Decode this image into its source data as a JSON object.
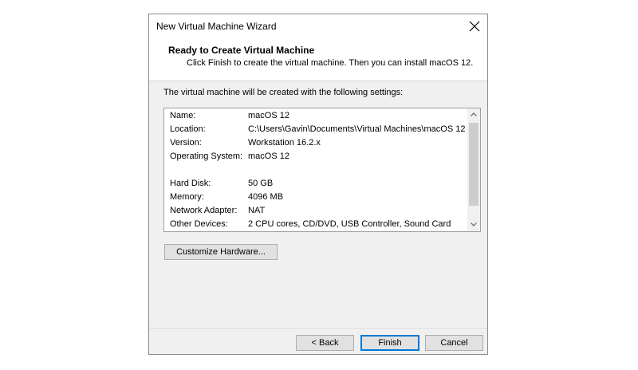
{
  "window": {
    "title": "New Virtual Machine Wizard"
  },
  "header": {
    "title": "Ready to Create Virtual Machine",
    "subtitle": "Click Finish to create the virtual machine. Then you can install macOS 12."
  },
  "intro": "The virtual machine will be created with the following settings:",
  "settings": [
    {
      "label": "Name:",
      "value": "macOS 12"
    },
    {
      "label": "Location:",
      "value": "C:\\Users\\Gavin\\Documents\\Virtual Machines\\macOS 12"
    },
    {
      "label": "Version:",
      "value": "Workstation 16.2.x"
    },
    {
      "label": "Operating System:",
      "value": "macOS 12"
    },
    {
      "label": "",
      "value": ""
    },
    {
      "label": "Hard Disk:",
      "value": "50 GB"
    },
    {
      "label": "Memory:",
      "value": "4096 MB"
    },
    {
      "label": "Network Adapter:",
      "value": "NAT"
    },
    {
      "label": "Other Devices:",
      "value": "2 CPU cores, CD/DVD, USB Controller, Sound Card"
    }
  ],
  "buttons": {
    "customize": "Customize Hardware...",
    "back": "< Back",
    "finish": "Finish",
    "cancel": "Cancel"
  },
  "icons": {
    "close": "close-icon",
    "scroll_up": "chevron-up-icon",
    "scroll_down": "chevron-down-icon"
  },
  "colors": {
    "default_button_border": "#0078d7",
    "dialog_background": "#f0f0f0"
  }
}
